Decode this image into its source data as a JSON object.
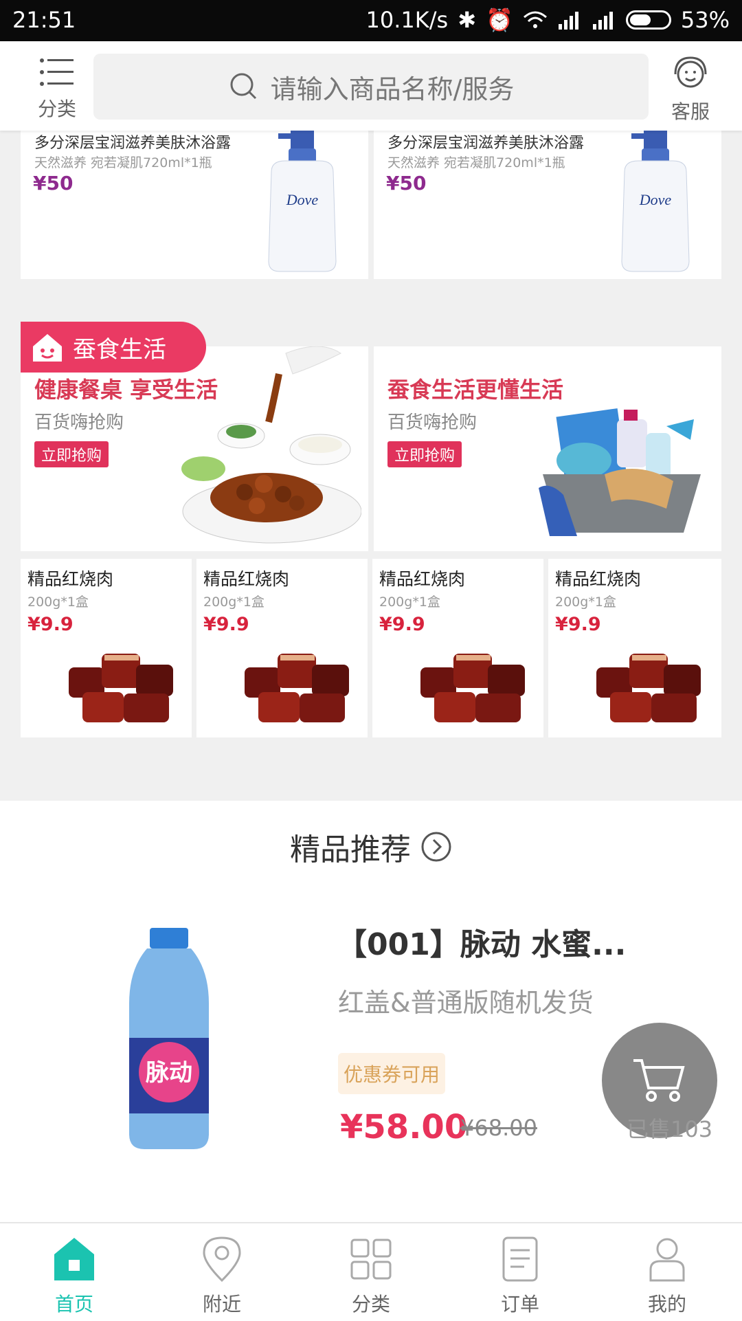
{
  "status_bar": {
    "time": "21:51",
    "speed": "10.1K/s",
    "battery": "53%"
  },
  "header": {
    "category_label": "分类",
    "search_placeholder": "请输入商品名称/服务",
    "service_label": "客服"
  },
  "dove_cards": [
    {
      "title": "多分深层宝润滋养美肤沐浴露",
      "subtitle": "天然滋养 宛若凝肌720ml*1瓶",
      "price": "¥50"
    },
    {
      "title": "多分深层宝润滋养美肤沐浴露",
      "subtitle": "天然滋养 宛若凝肌720ml*1瓶",
      "price": "¥50"
    }
  ],
  "bottle_brand": "Dove",
  "section_tag": "蚕食生活",
  "promos": [
    {
      "title": "健康餐桌 享受生活",
      "subtitle": "百货嗨抢购",
      "button": "立即抢购"
    },
    {
      "title": "蚕食生活更懂生活",
      "subtitle": "百货嗨抢购",
      "button": "立即抢购"
    }
  ],
  "pork_cards": [
    {
      "name": "精品红烧肉",
      "sub": "200g*1盒",
      "price": "¥9.9"
    },
    {
      "name": "精品红烧肉",
      "sub": "200g*1盒",
      "price": "¥9.9"
    },
    {
      "name": "精品红烧肉",
      "sub": "200g*1盒",
      "price": "¥9.9"
    },
    {
      "name": "精品红烧肉",
      "sub": "200g*1盒",
      "price": "¥9.9"
    }
  ],
  "featured": {
    "title": "精品推荐",
    "product": {
      "name": "【001】脉动 水蜜...",
      "desc": "红盖&普通版随机发货",
      "coupon": "优惠券可用",
      "price": "¥58.00",
      "old_price": "¥68.00",
      "sold": "已售103",
      "bottle_label": "脉动"
    }
  },
  "bottom_nav": [
    {
      "label": "首页",
      "active": true
    },
    {
      "label": "附近",
      "active": false
    },
    {
      "label": "分类",
      "active": false
    },
    {
      "label": "订单",
      "active": false
    },
    {
      "label": "我的",
      "active": false
    }
  ],
  "colors": {
    "accent": "#1bc3b0",
    "price_red": "#e8335a",
    "tag_pink": "#ea3a63",
    "dove_price": "#8e2a8e"
  }
}
